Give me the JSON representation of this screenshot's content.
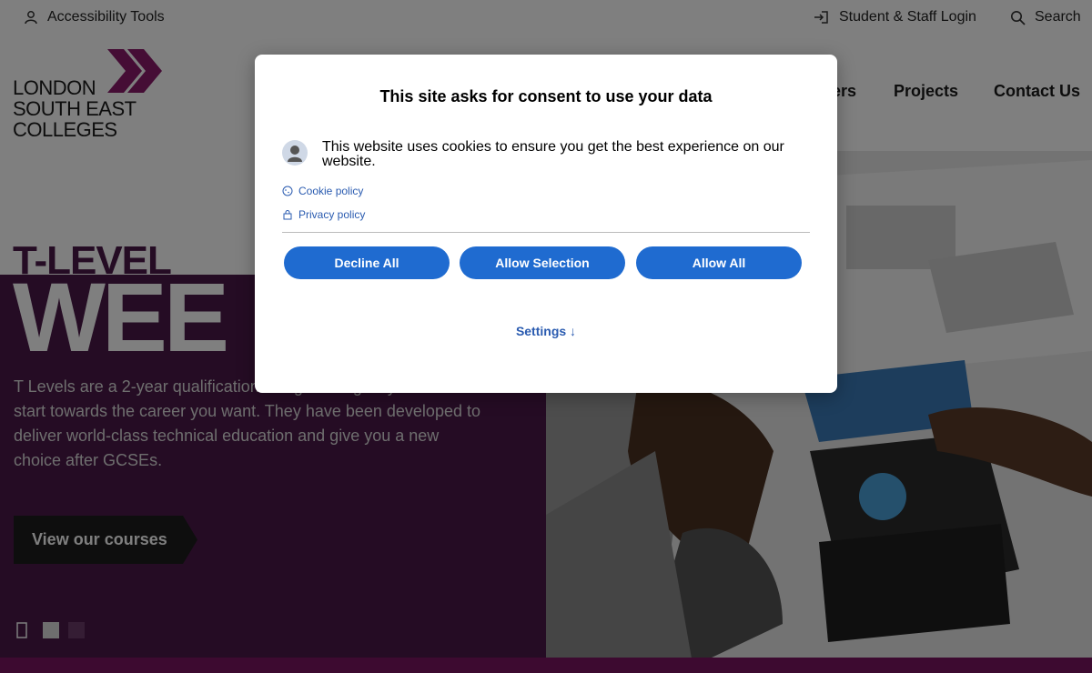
{
  "topbar": {
    "accessibility": "Accessibility Tools",
    "login": "Student & Staff Login",
    "search": "Search"
  },
  "logo": {
    "line1": "LONDON",
    "line2": "SOUTH EAST",
    "line3": "COLLEGES"
  },
  "nav": [
    {
      "label": "ers"
    },
    {
      "label": "Projects"
    },
    {
      "label": "Contact Us"
    }
  ],
  "hero": {
    "tlevel": "T-LEVEL",
    "week": "WEE",
    "description": "T Levels are a 2-year qualification designed to give you a head start towards the career you want. They have been developed to deliver world-class technical education and give you a new choice after GCSEs.",
    "cta": "View our courses"
  },
  "modal": {
    "title": "This site asks for consent to use your data",
    "message": "This website uses cookies to ensure you get the best experience on our website.",
    "cookie_policy": "Cookie policy",
    "privacy_policy": "Privacy policy",
    "decline": "Decline All",
    "allow_selection": "Allow Selection",
    "allow_all": "Allow All",
    "settings": "Settings ↓"
  },
  "colors": {
    "brand_purple": "#4a1848",
    "brand_magenta": "#7a1560",
    "button_blue": "#1f6bd0",
    "link_blue": "#2a5bb0"
  }
}
